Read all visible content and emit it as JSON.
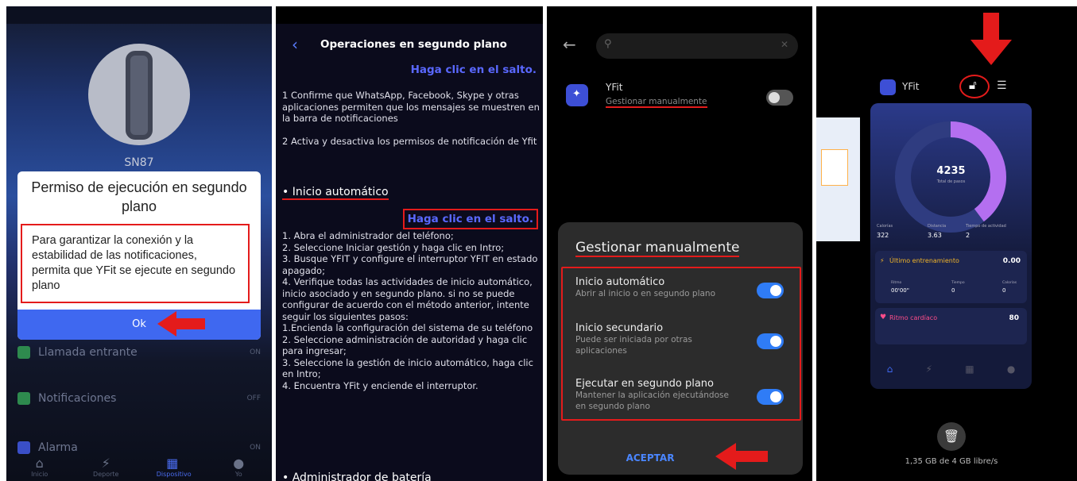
{
  "panel1": {
    "device_name": "SN87",
    "dialog": {
      "title": "Permiso de ejecución en segundo plano",
      "body": "Para garantizar la conexión y la estabilidad de las notificaciones, permita que YFit se ejecute en segundo plano",
      "ok": "Ok"
    },
    "rows": [
      {
        "label": "Llamada entrante",
        "value": "ON"
      },
      {
        "label": "Notificaciones",
        "value": "OFF"
      },
      {
        "label": "Alarma",
        "value": "ON"
      }
    ],
    "tabs": [
      "Inicio",
      "Deporte",
      "Dispositivo",
      "Yo"
    ]
  },
  "panel2": {
    "header": "Operaciones en segundo plano",
    "link1": "Haga clic en el salto.",
    "para1": "1 Confirme que WhatsApp, Facebook, Skype y otras aplicaciones permiten que los mensajes se muestren en la barra de notificaciones",
    "para2": "2 Activa y desactiva los permisos de notificación de Yfit",
    "section1": "Inicio automático",
    "link2": "Haga clic en el salto.",
    "steps": [
      "1. Abra el administrador del teléfono;",
      "2. Seleccione Iniciar gestión y haga clic en Intro;",
      "3. Busque YFIT y configure el interruptor YFIT en estado apagado;",
      "4. Verifique todas las actividades de inicio automático, inicio asociado y en segundo plano. si no se puede configurar de acuerdo con el método anterior, intente seguir los siguientes pasos:",
      "1.Encienda la configuración del sistema de su teléfono",
      "2. Seleccione administración de autoridad y haga clic para ingresar;",
      "3. Seleccione la gestión de inicio automático, haga clic en Intro;",
      "4. Encuentra YFit y enciende el interruptor."
    ],
    "section2": "Administrador de batería"
  },
  "panel3": {
    "app_name": "YFit",
    "app_status": "Gestionar manualmente",
    "sheet_title": "Gestionar manualmente",
    "options": [
      {
        "title": "Inicio automático",
        "sub": "Abrir al inicio o en segundo plano",
        "on": true
      },
      {
        "title": "Inicio secundario",
        "sub": "Puede ser iniciada por otras aplicaciones",
        "on": true
      },
      {
        "title": "Ejecutar en segundo plano",
        "sub": "Mantener la aplicación ejecutándose en segundo plano",
        "on": true
      }
    ],
    "accept": "ACEPTAR"
  },
  "panel4": {
    "app_name": "YFit",
    "steps": "4235",
    "steps_label": "Total de pasos",
    "stats": [
      {
        "label": "Calorías",
        "value": "322"
      },
      {
        "label": "Distancia",
        "value": "3.63"
      },
      {
        "label": "Tiempo de actividad",
        "value": "2"
      }
    ],
    "workout_title": "Último entrenamiento",
    "workout_value": "0.00",
    "workout_cols": [
      {
        "label": "Ritmo",
        "value": "00'00\""
      },
      {
        "label": "Tiempo",
        "value": "0"
      },
      {
        "label": "Calorías",
        "value": "0"
      }
    ],
    "heart_title": "Ritmo cardíaco",
    "heart_value": "80",
    "storage": "1,35 GB de 4 GB libre/s"
  }
}
